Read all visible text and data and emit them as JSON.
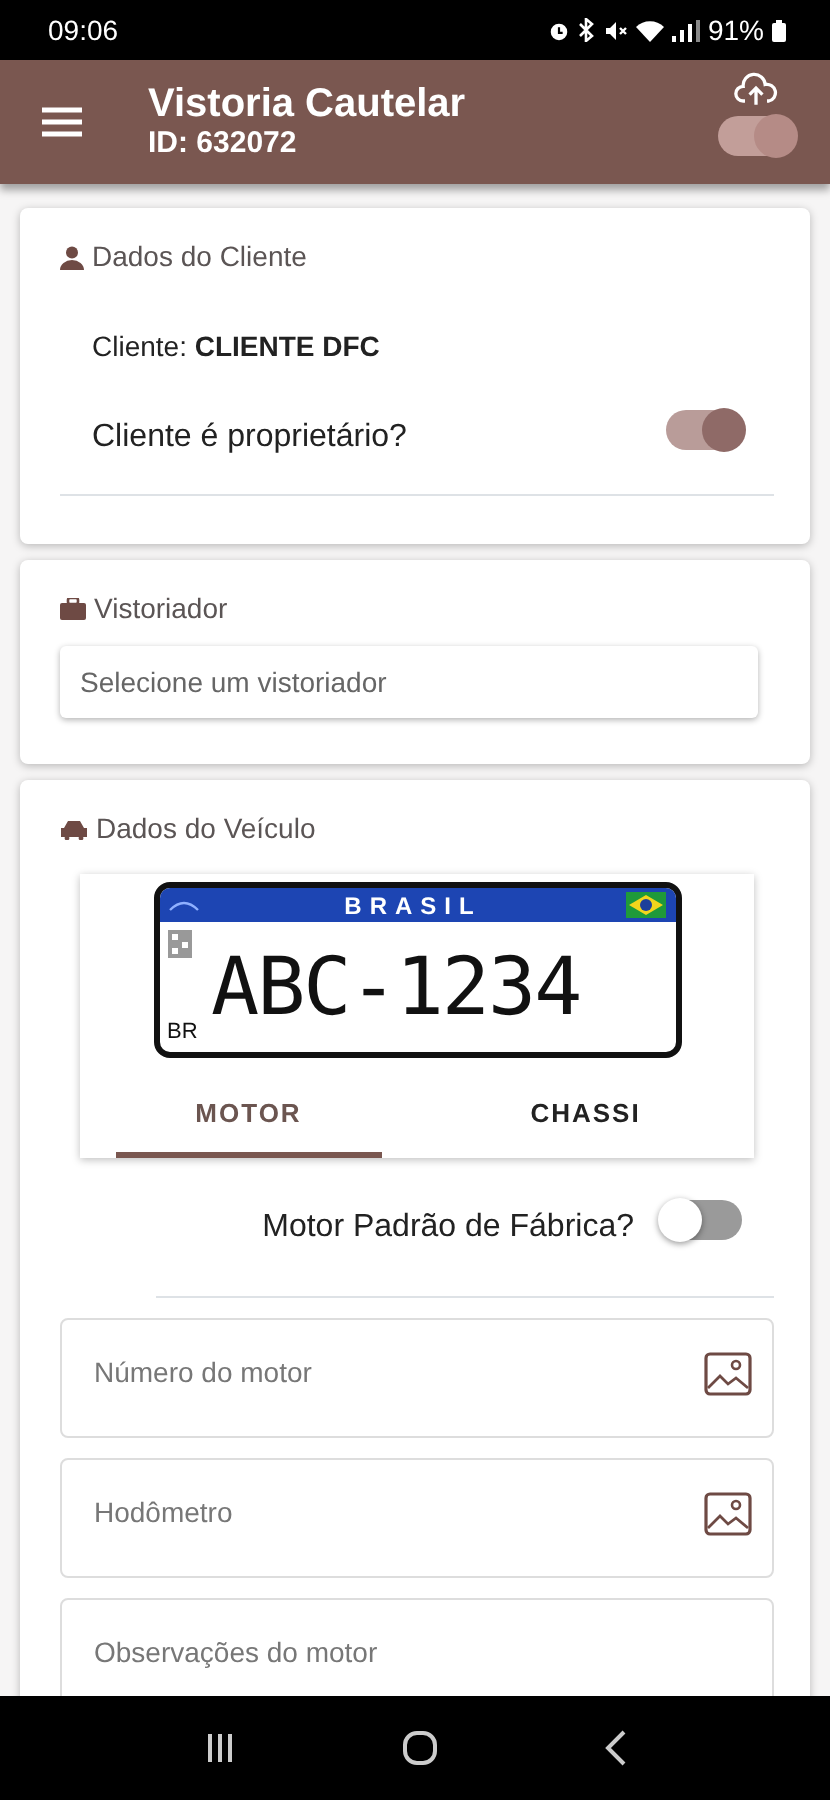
{
  "status_bar": {
    "time": "09:06",
    "battery": "91%"
  },
  "header": {
    "title": "Vistoria Cautelar",
    "subtitle": "ID: 632072",
    "sync_toggle": {
      "on": true
    }
  },
  "client_section": {
    "title": "Dados do Cliente",
    "client": "Cliente: **CLIENTE DFC**",
    "owner_toggle": {
      "label": "Cliente é proprietário?",
      "on": true
    }
  },
  "inspector_section": {
    "title": "Vistoriador",
    "select": {
      "placeholder": "Selecione um vistoriador"
    }
  },
  "vehicle_section": {
    "title": "Dados do Veículo",
    "plate": {
      "country": "BRASIL",
      "code": "BR",
      "number": "ABC-1234"
    },
    "tabs": [
      {
        "label": "MOTOR",
        "selected": true
      },
      {
        "label": "CHASSI",
        "selected": false
      }
    ],
    "factory_toggle": {
      "label": "Motor Padrão de Fábrica?",
      "on": false
    },
    "fields": [
      {
        "placeholder": "Número do motor",
        "kind": "photo"
      },
      {
        "placeholder": "Hodômetro",
        "kind": "photo"
      },
      {
        "placeholder": "Observações do motor",
        "kind": "text"
      }
    ]
  }
}
